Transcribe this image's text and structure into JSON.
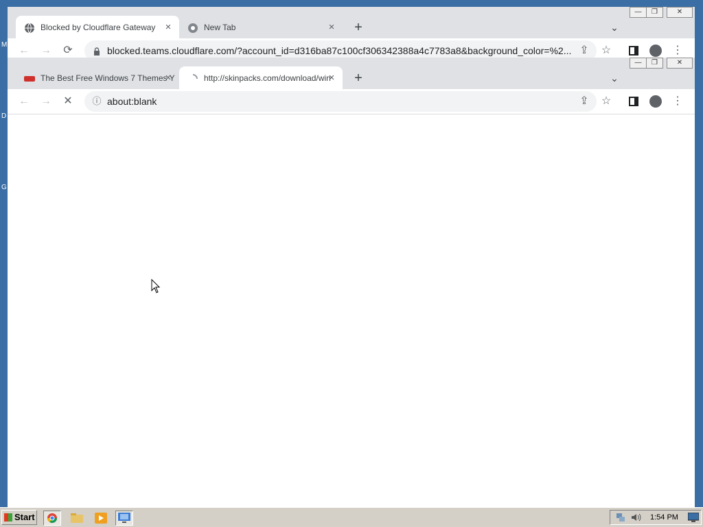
{
  "desktop": {
    "glyph_top": "M",
    "glyph_mid": "D",
    "glyph_low": "G"
  },
  "window_back": {
    "tabs": [
      {
        "title": "Blocked by Cloudflare Gateway",
        "active": true
      },
      {
        "title": "New Tab",
        "active": false
      }
    ],
    "url": "blocked.teams.cloudflare.com/?account_id=d316ba87c100cf306342388a4c7783a8&background_color=%2..."
  },
  "window_front": {
    "tabs": [
      {
        "title": "The Best Free Windows 7 Themes Y",
        "active": false
      },
      {
        "title": "http://skinpacks.com/download/win",
        "active": true
      }
    ],
    "url": "about:blank"
  },
  "icons": {
    "close": "×",
    "new_tab": "+",
    "tab_search": "⌄",
    "back": "←",
    "forward": "→",
    "reload": "⟳",
    "stop": "✕",
    "share": "⇪",
    "star": "☆",
    "menu": "⋮",
    "info": "ⓘ",
    "lock": "🔒",
    "minimize": "—",
    "restore": "❐",
    "win_close": "✕"
  },
  "taskbar": {
    "start_label": "Start",
    "clock": "1:54 PM"
  },
  "colors": {
    "desktop": "#3a6ea5",
    "tabstrip": "#dfe1e5",
    "taskbar": "#d4d0c8"
  }
}
